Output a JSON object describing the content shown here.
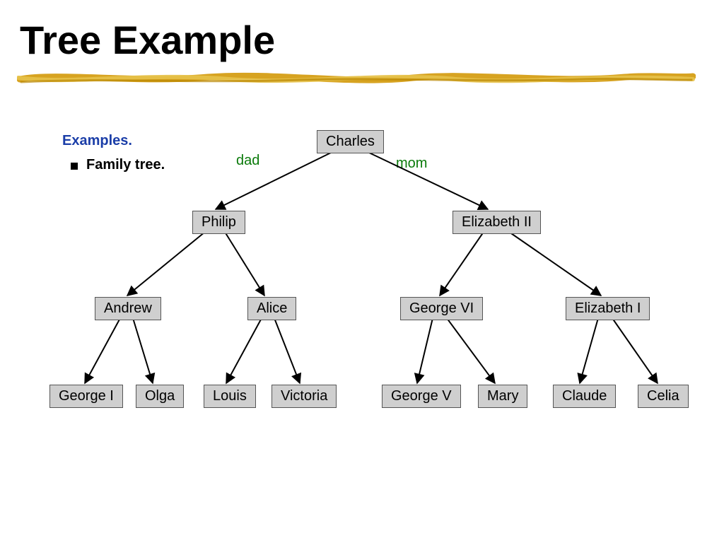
{
  "title": "Tree Example",
  "heading": "Examples.",
  "bullet": "Family tree.",
  "edge_labels": {
    "dad": "dad",
    "mom": "mom"
  },
  "tree": {
    "root": {
      "name": "Charles",
      "children": [
        {
          "name": "Philip",
          "children": [
            {
              "name": "Andrew",
              "children": [
                {
                  "name": "George I"
                },
                {
                  "name": "Olga"
                }
              ]
            },
            {
              "name": "Alice",
              "children": [
                {
                  "name": "Louis"
                },
                {
                  "name": "Victoria"
                }
              ]
            }
          ]
        },
        {
          "name": "Elizabeth II",
          "children": [
            {
              "name": "George VI",
              "children": [
                {
                  "name": "George V"
                },
                {
                  "name": "Mary"
                }
              ]
            },
            {
              "name": "Elizabeth I",
              "children": [
                {
                  "name": "Claude"
                },
                {
                  "name": "Celia"
                }
              ]
            }
          ]
        }
      ]
    }
  },
  "nodes": {
    "charles": "Charles",
    "philip": "Philip",
    "elizabeth2": "Elizabeth II",
    "andrew": "Andrew",
    "alice": "Alice",
    "george6": "George VI",
    "elizabeth1": "Elizabeth I",
    "george1": "George I",
    "olga": "Olga",
    "louis": "Louis",
    "victoria": "Victoria",
    "george5": "George V",
    "mary": "Mary",
    "claude": "Claude",
    "celia": "Celia"
  }
}
